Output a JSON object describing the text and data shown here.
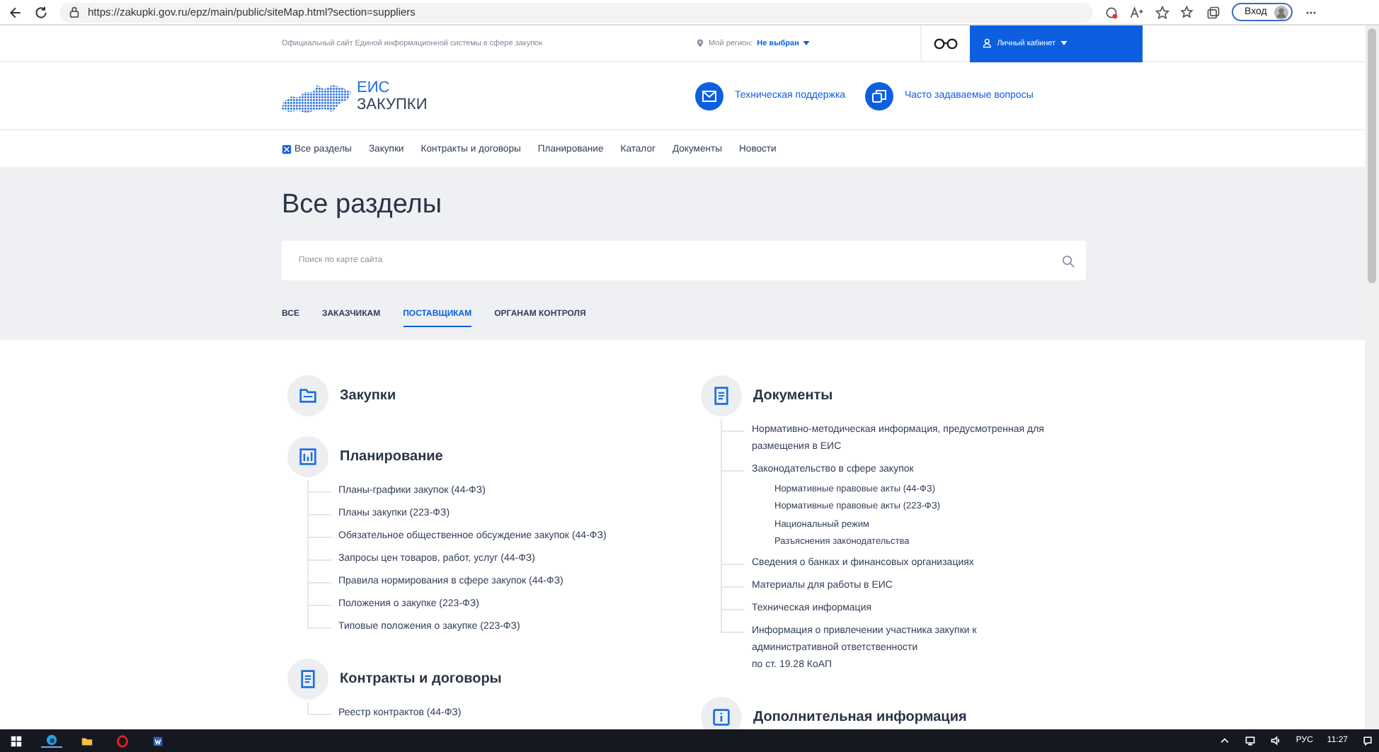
{
  "browser": {
    "url": "https://zakupki.gov.ru/epz/main/public/siteMap.html?section=suppliers",
    "login_button": "Вход"
  },
  "topbar": {
    "caption": "Официальный сайт Единой информационной системы в сфере закупок",
    "region_label": "Мой регион:",
    "region_value": "Не выбран",
    "cabinet": "Личный кабинет"
  },
  "header": {
    "logo_top": "ЕИС",
    "logo_bottom": "ЗАКУПКИ",
    "links": [
      {
        "label": "Техническая поддержка",
        "kind": "mail"
      },
      {
        "label": "Часто задаваемые вопросы",
        "kind": "faq"
      }
    ]
  },
  "nav": [
    {
      "label": "Все разделы",
      "kind": "all"
    },
    {
      "label": "Закупки",
      "kind": "link"
    },
    {
      "label": "Контракты и договоры",
      "kind": "link"
    },
    {
      "label": "Планирование",
      "kind": "link"
    },
    {
      "label": "Каталог",
      "kind": "link"
    },
    {
      "label": "Документы",
      "kind": "link"
    },
    {
      "label": "Новости",
      "kind": "link"
    }
  ],
  "page_title": "Все разделы",
  "search": {
    "placeholder": "Поиск по карте сайта"
  },
  "tabs": [
    {
      "label": "ВСЕ",
      "selected": false
    },
    {
      "label": "ЗАКАЗЧИКАМ",
      "selected": false
    },
    {
      "label": "ПОСТАВЩИКАМ",
      "selected": true
    },
    {
      "label": "ОРГАНАМ КОНТРОЛЯ",
      "selected": false
    }
  ],
  "columns": [
    [
      {
        "title": "Закупки",
        "kind": "folder"
      },
      {
        "title": "Планирование",
        "kind": "chart",
        "items": [
          {
            "label": "Планы-графики закупок (44-ФЗ)"
          },
          {
            "label": "Планы закупки (223-ФЗ)"
          },
          {
            "label": "Обязательное общественное обсуждение закупок (44-ФЗ)"
          },
          {
            "label": "Запросы цен товаров, работ, услуг (44-ФЗ)"
          },
          {
            "label": "Правила нормирования в сфере закупок (44-ФЗ)"
          },
          {
            "label": "Положения о закупке (223-ФЗ)"
          },
          {
            "label": "Типовые положения о закупке (223-ФЗ)"
          }
        ]
      },
      {
        "title": "Контракты и договоры",
        "kind": "doc",
        "items": [
          {
            "label": "Реестр контрактов (44-ФЗ)"
          }
        ]
      }
    ],
    [
      {
        "title": "Документы",
        "kind": "doc",
        "items": [
          {
            "label": "Нормативно-методическая информация, предусмотренная для размещения в ЕИС"
          },
          {
            "label": "Законодательство в сфере закупок",
            "children": [
              {
                "label": "Нормативные правовые акты (44-ФЗ)"
              },
              {
                "label": "Нормативные правовые акты (223-ФЗ)"
              },
              {
                "label": "Национальный режим"
              },
              {
                "label": "Разъяснения законодательства"
              }
            ]
          },
          {
            "label": "Сведения о банках и финансовых организациях"
          },
          {
            "label": "Материалы для работы в ЕИС"
          },
          {
            "label": "Техническая информация"
          },
          {
            "label": "Информация о привлечении участника закупки к административной ответственности\nпо ст. 19.28 КоАП"
          }
        ]
      },
      {
        "title": "Дополнительная информация",
        "kind": "info"
      }
    ]
  ],
  "taskbar": {
    "language": "РУС",
    "time": "11:27"
  }
}
